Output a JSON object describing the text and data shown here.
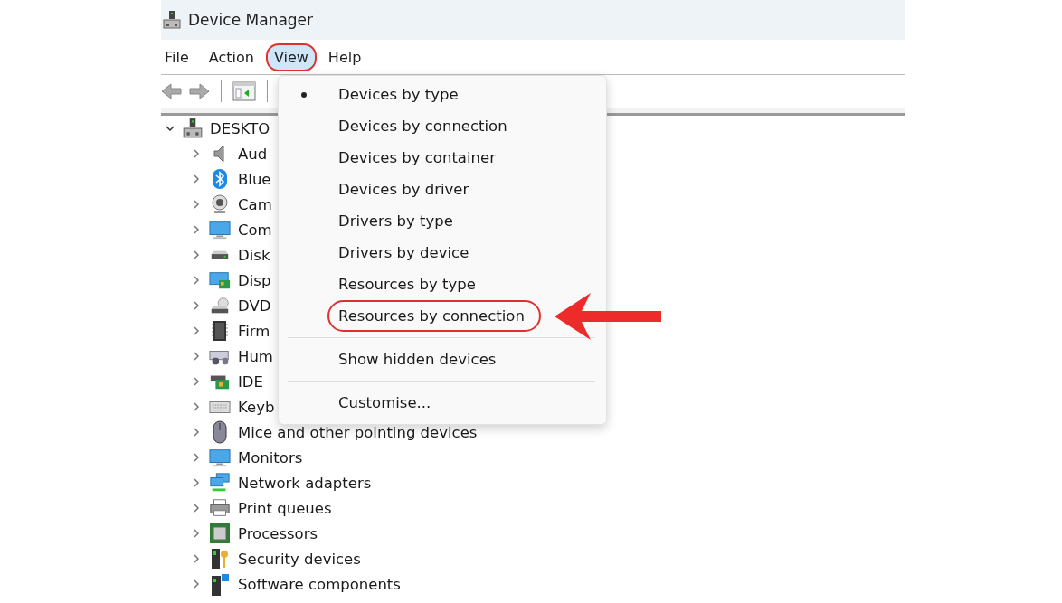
{
  "window": {
    "title": "Device Manager"
  },
  "menu_bar": [
    {
      "label": "File",
      "selected": false,
      "circled": false
    },
    {
      "label": "Action",
      "selected": false,
      "circled": false
    },
    {
      "label": "View",
      "selected": true,
      "circled": true
    },
    {
      "label": "Help",
      "selected": false,
      "circled": false
    }
  ],
  "tree": {
    "label": "DESKTO",
    "expanded": true,
    "children": [
      {
        "label": "Aud",
        "expanded": false
      },
      {
        "label": "Blue",
        "expanded": false
      },
      {
        "label": "Cam",
        "expanded": false
      },
      {
        "label": "Com",
        "expanded": false
      },
      {
        "label": "Disk",
        "expanded": false
      },
      {
        "label": "Disp",
        "expanded": false
      },
      {
        "label": "DVD",
        "expanded": false
      },
      {
        "label": "Firm",
        "expanded": false
      },
      {
        "label": "Hum",
        "expanded": false
      },
      {
        "label": "IDE",
        "expanded": false
      },
      {
        "label": "Keyb",
        "expanded": false
      },
      {
        "label": "Mice and other pointing devices",
        "expanded": false
      },
      {
        "label": "Monitors",
        "expanded": false
      },
      {
        "label": "Network adapters",
        "expanded": false
      },
      {
        "label": "Print queues",
        "expanded": false
      },
      {
        "label": "Processors",
        "expanded": false
      },
      {
        "label": "Security devices",
        "expanded": false
      },
      {
        "label": "Software components",
        "expanded": false
      }
    ]
  },
  "view_menu": [
    {
      "kind": "item",
      "label": "Devices by type",
      "checked": true,
      "circled": false
    },
    {
      "kind": "item",
      "label": "Devices by connection",
      "checked": false,
      "circled": false
    },
    {
      "kind": "item",
      "label": "Devices by container",
      "checked": false,
      "circled": false
    },
    {
      "kind": "item",
      "label": "Devices by driver",
      "checked": false,
      "circled": false
    },
    {
      "kind": "item",
      "label": "Drivers by type",
      "checked": false,
      "circled": false
    },
    {
      "kind": "item",
      "label": "Drivers by device",
      "checked": false,
      "circled": false
    },
    {
      "kind": "item",
      "label": "Resources by type",
      "checked": false,
      "circled": false
    },
    {
      "kind": "item",
      "label": "Resources by connection",
      "checked": false,
      "circled": true
    },
    {
      "kind": "separator"
    },
    {
      "kind": "item",
      "label": "Show hidden devices",
      "checked": false,
      "circled": false
    },
    {
      "kind": "separator"
    },
    {
      "kind": "item",
      "label": "Customise...",
      "checked": false,
      "circled": false
    }
  ]
}
